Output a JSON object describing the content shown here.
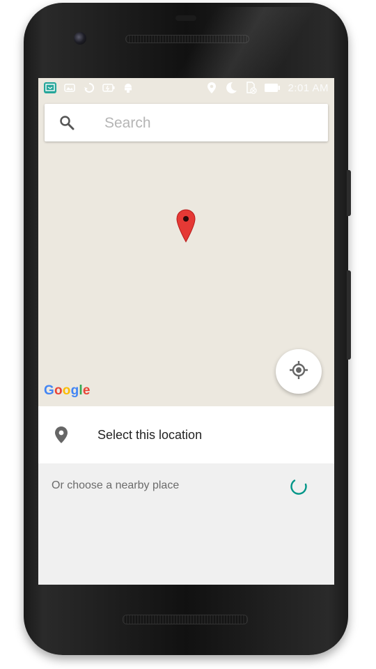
{
  "status_bar": {
    "time": "2:01 AM",
    "left_icons": [
      "screen-cast-icon",
      "photo-icon",
      "sync-icon",
      "battery-saver-icon",
      "android-debug-icon"
    ],
    "right_icons": [
      "location-icon",
      "do-not-disturb-moon-icon",
      "sd-card-icon",
      "battery-icon"
    ]
  },
  "search": {
    "placeholder": "Search"
  },
  "map": {
    "attribution": "Google",
    "pin_color": "#e53935"
  },
  "select_location": {
    "label": "Select this location"
  },
  "nearby": {
    "label": "Or choose a nearby place"
  },
  "colors": {
    "map_background": "#ece8df",
    "spinner": "#009688",
    "accent": "#ffffff"
  }
}
